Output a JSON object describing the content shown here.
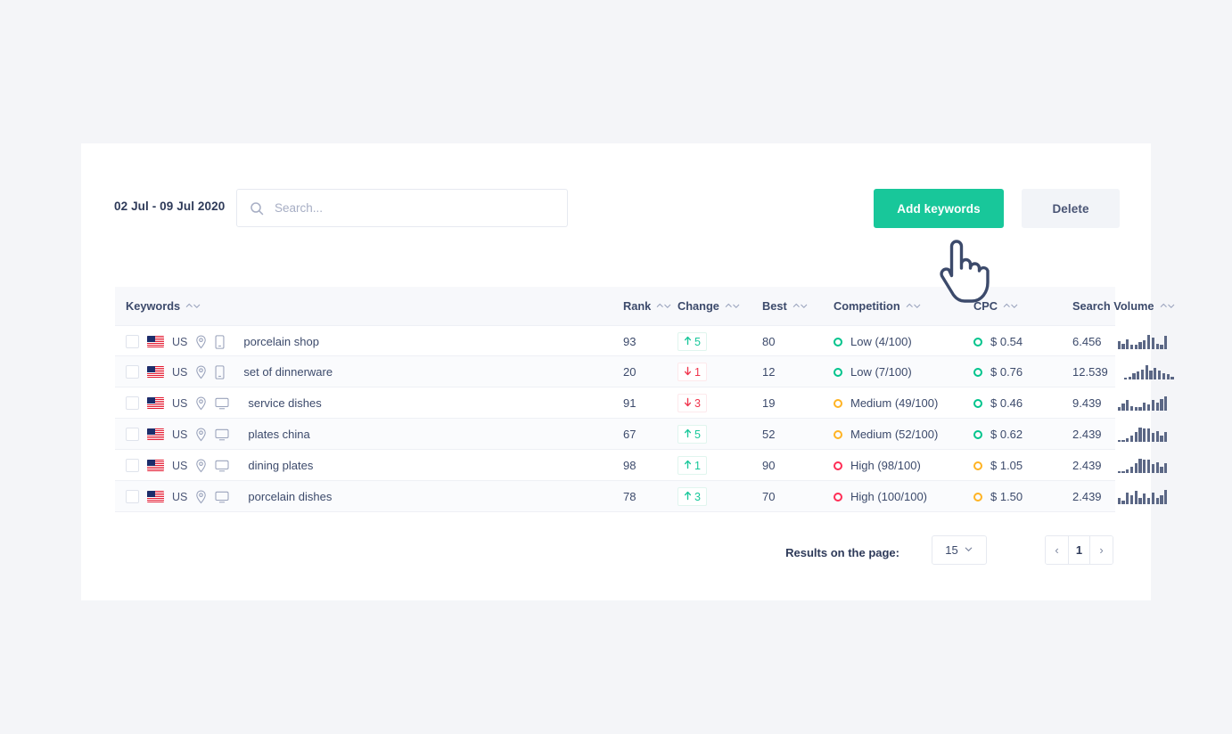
{
  "toolbar": {
    "date_range": "02 Jul - 09 Jul 2020",
    "search_placeholder": "Search...",
    "search_value": "",
    "add_keywords_label": "Add keywords",
    "delete_label": "Delete"
  },
  "colors": {
    "accent": "#18c79a",
    "low": "#00c48c",
    "medium": "#ffb323",
    "high": "#ff2d55",
    "up": "#18c79a",
    "down": "#f0344c",
    "text": "#3c4a6b",
    "header_bg": "#f7f8fb",
    "page_bg": "#f4f5f8"
  },
  "table": {
    "columns": [
      {
        "key": "keywords",
        "label": "Keywords",
        "sortable": true
      },
      {
        "key": "rank",
        "label": "Rank",
        "sortable": true
      },
      {
        "key": "change",
        "label": "Change",
        "sortable": true
      },
      {
        "key": "best",
        "label": "Best",
        "sortable": true
      },
      {
        "key": "competition",
        "label": "Competition",
        "sortable": true
      },
      {
        "key": "cpc",
        "label": "CPC",
        "sortable": true
      },
      {
        "key": "search_volume",
        "label": "Search Volume",
        "sortable": true
      }
    ],
    "rows": [
      {
        "selected": false,
        "country": "US",
        "device": "mobile",
        "keyword": "porcelain shop",
        "rank": "93",
        "change": {
          "direction": "up",
          "value": "5"
        },
        "best": "80",
        "competition": {
          "level": "Low",
          "text": "Low (4/100)",
          "score": 4
        },
        "cpc": "$ 0.54",
        "search_volume": "6.456",
        "sparkline": [
          8,
          5,
          10,
          4,
          4,
          7,
          9,
          14,
          11,
          5,
          4,
          13
        ]
      },
      {
        "selected": false,
        "country": "US",
        "device": "mobile",
        "keyword": "set of dinnerware",
        "rank": "20",
        "change": {
          "direction": "down",
          "value": "1"
        },
        "best": "12",
        "competition": {
          "level": "Low",
          "text": "Low (7/100)",
          "score": 7
        },
        "cpc": "$ 0.76",
        "search_volume": "12.539",
        "sparkline": [
          2,
          3,
          6,
          8,
          10,
          14,
          9,
          11,
          9,
          6,
          5,
          3
        ]
      },
      {
        "selected": false,
        "country": "US",
        "device": "desktop",
        "keyword": "service dishes",
        "rank": "91",
        "change": {
          "direction": "down",
          "value": "3"
        },
        "best": "19",
        "competition": {
          "level": "Medium",
          "text": "Medium (49/100)",
          "score": 49
        },
        "cpc": "$ 0.46",
        "search_volume": "9.439",
        "sparkline": [
          3,
          6,
          9,
          4,
          3,
          3,
          7,
          5,
          9,
          7,
          10,
          12
        ]
      },
      {
        "selected": false,
        "country": "US",
        "device": "desktop",
        "keyword": "plates china",
        "rank": "67",
        "change": {
          "direction": "up",
          "value": "5"
        },
        "best": "52",
        "competition": {
          "level": "Medium",
          "text": "Medium (52/100)",
          "score": 52
        },
        "cpc": "$ 0.62",
        "search_volume": "2.439",
        "sparkline": [
          2,
          2,
          3,
          6,
          9,
          13,
          12,
          12,
          8,
          10,
          6,
          9
        ]
      },
      {
        "selected": false,
        "country": "US",
        "device": "desktop",
        "keyword": "dining plates",
        "rank": "98",
        "change": {
          "direction": "up",
          "value": "1"
        },
        "best": "90",
        "competition": {
          "level": "High",
          "text": "High (98/100)",
          "score": 98
        },
        "cpc": "$ 1.05",
        "search_volume": "2.439",
        "sparkline": [
          2,
          2,
          3,
          6,
          9,
          13,
          12,
          12,
          8,
          10,
          6,
          9
        ]
      },
      {
        "selected": false,
        "country": "US",
        "device": "desktop",
        "keyword": "porcelain dishes",
        "rank": "78",
        "change": {
          "direction": "up",
          "value": "3"
        },
        "best": "70",
        "competition": {
          "level": "High",
          "text": "High (100/100)",
          "score": 100
        },
        "cpc": "$ 1.50",
        "search_volume": "2.439",
        "sparkline": [
          5,
          3,
          9,
          7,
          10,
          5,
          8,
          5,
          9,
          5,
          7,
          11
        ]
      }
    ]
  },
  "pagination": {
    "results_label": "Results on the page:",
    "per_page": "15",
    "prev": "‹",
    "current_page": "1",
    "next": "›"
  },
  "cursor": {
    "icon": "pointing-hand-cursor"
  }
}
